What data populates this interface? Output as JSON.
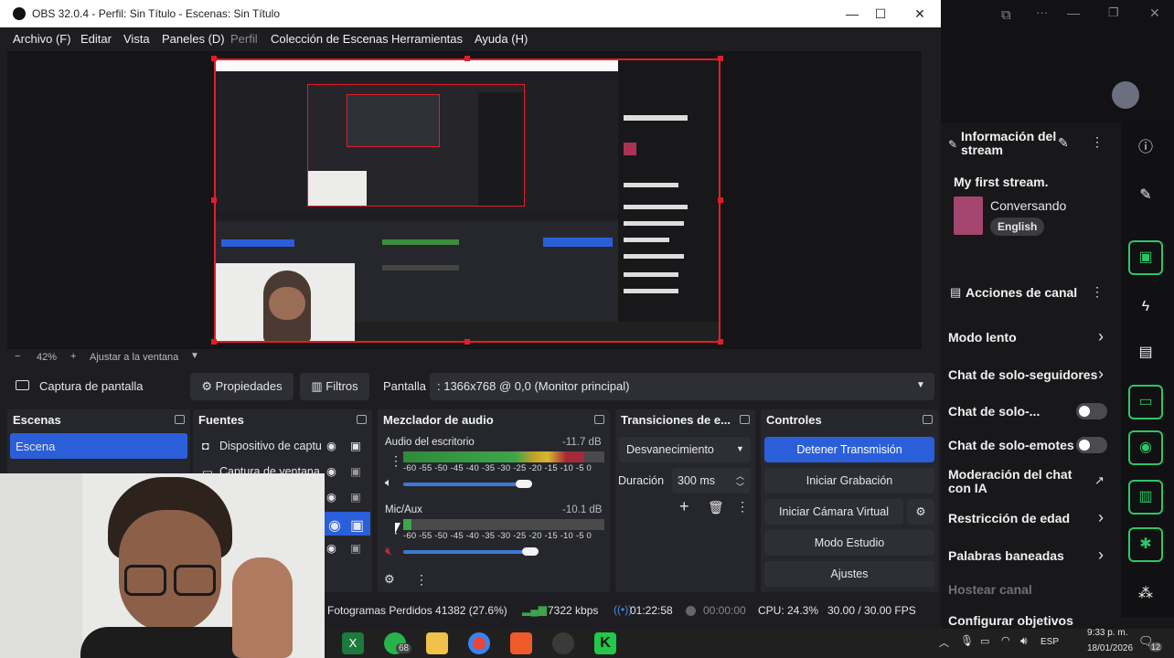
{
  "window": {
    "title": "OBS 32.0.4 - Perfil: Sin Título - Escenas: Sin Título",
    "minimize": "—",
    "maximize": "☐",
    "close": "✕"
  },
  "menu": [
    "Archivo (F)",
    "Editar",
    "Vista",
    "Paneles (D)",
    "Perfil",
    "Colección de Escenas",
    "Herramientas",
    "Ayuda (H)"
  ],
  "zoom": {
    "minus": "−",
    "value": "42%",
    "plus": "+",
    "fit_label": "Ajustar a la ventana"
  },
  "source_toolbar": {
    "source_name": "Captura de pantalla",
    "properties": "Propiedades",
    "filters": "Filtros",
    "display_label": "Pantalla",
    "display_value": ": 1366x768 @ 0,0 (Monitor principal)"
  },
  "scenes": {
    "title": "Escenas",
    "items": [
      "Escena"
    ]
  },
  "sources": {
    "title": "Fuentes",
    "items": [
      "Dispositivo de captu",
      "Captura de ventana"
    ]
  },
  "mixer": {
    "title": "Mezclador de audio",
    "channels": [
      {
        "name": "Audio del escritorio",
        "db": "-11.7 dB",
        "level": 0.9,
        "volume": 0.6
      },
      {
        "name": "Mic/Aux",
        "db": "-10.1 dB",
        "level": 0.04,
        "volume": 0.63
      }
    ],
    "ticks": "-60 -55 -50 -45 -40 -35 -30 -25 -20 -15 -10 -5 0"
  },
  "transitions": {
    "title": "Transiciones de e...",
    "selected": "Desvanecimiento",
    "duration_label": "Duración",
    "duration_value": "300 ms"
  },
  "controls": {
    "title": "Controles",
    "stop_stream": "Detener Transmisión",
    "start_recording": "Iniciar Grabación",
    "virtual_camera": "Iniciar Cámara Virtual",
    "studio_mode": "Modo Estudio",
    "settings": "Ajustes"
  },
  "status": {
    "dropped_frames": "Fotogramas Perdidos 41382 (27.6%)",
    "bitrate": "7322 kbps",
    "stream_time": "01:22:58",
    "record_time": "00:00:00",
    "cpu": "CPU: 24.3%",
    "fps": "30.00 / 30.00 FPS"
  },
  "dashboard": {
    "stream_info_title": "Información del stream",
    "stream_title": "My first stream.",
    "category": "Conversando",
    "language": "English",
    "channel_actions_title": "Acciones de canal",
    "actions": [
      "Modo lento",
      "Chat de solo-seguidores",
      "Chat de solo-...",
      "Chat de solo-emotes",
      "Moderación del chat con IA",
      "Restricción de edad",
      "Palabras baneadas",
      "Hostear canal",
      "Configurar objetivos"
    ]
  },
  "taskbar": {
    "whatsapp_badge": "68",
    "lang": "ESP",
    "time": "9:33 p. m.",
    "date": "18/01/2026",
    "notifications": "12"
  },
  "colors": {
    "accent_blue": "#2b5fd9",
    "selection_red": "#e11d2b",
    "twitch_green": "#2ec46a"
  }
}
